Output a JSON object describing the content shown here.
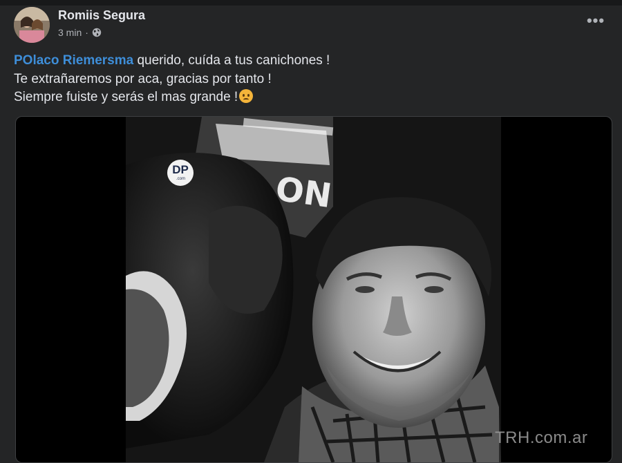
{
  "post": {
    "author": "Romiis Segura",
    "time": "3 min",
    "separator": "·",
    "privacy_icon": "globe-icon",
    "more_icon": "more-options-icon",
    "more_label": "•••",
    "mention": "POlaco Riemersma",
    "line1_rest": " querido, cuída a tus canichones !",
    "line2": "Te extrañaremos por aca, gracias por tanto !",
    "line3": "Siempre fuiste y serás el mas grande !",
    "emoji": "sad-face-emoji"
  },
  "media": {
    "logo_text": "DP",
    "logo_sub": ".com",
    "photo_label": "DP.com"
  },
  "watermark": "TRH.com.ar",
  "colors": {
    "background": "#242526",
    "text": "#e4e6eb",
    "secondary_text": "#b0b3b8",
    "mention": "#3e8ed9"
  }
}
